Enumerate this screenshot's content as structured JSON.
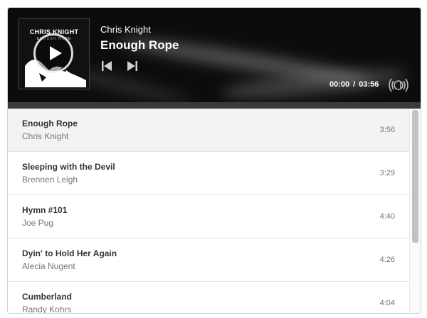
{
  "header": {
    "album_art": {
      "title": "CHRIS KNIGHT",
      "subtitle": "ENOUGH ROPE"
    },
    "now_playing": {
      "artist": "Chris Knight",
      "title": "Enough Rope"
    },
    "controls": {
      "play_icon": "play-icon",
      "prev_icon": "skip-previous-icon",
      "next_icon": "skip-next-icon"
    },
    "time": {
      "current": "00:00",
      "separator": "/",
      "total": "03:56"
    },
    "logo_icon": "audio-logo-icon"
  },
  "playlist": [
    {
      "title": "Enough Rope",
      "artist": "Chris Knight",
      "duration": "3:56",
      "active": true
    },
    {
      "title": "Sleeping with the Devil",
      "artist": "Brennen Leigh",
      "duration": "3:29"
    },
    {
      "title": "Hymn #101",
      "artist": "Joe Pug",
      "duration": "4:40"
    },
    {
      "title": "Dyin' to Hold Her Again",
      "artist": "Alecia Nugent",
      "duration": "4:26"
    },
    {
      "title": "Cumberland",
      "artist": "Randy Kohrs",
      "duration": "4:04"
    }
  ],
  "colors": {
    "header_bg": "#0c0c0c",
    "active_row_bg": "#f3f3f3",
    "title_text": "#333333",
    "meta_text": "#777777"
  }
}
